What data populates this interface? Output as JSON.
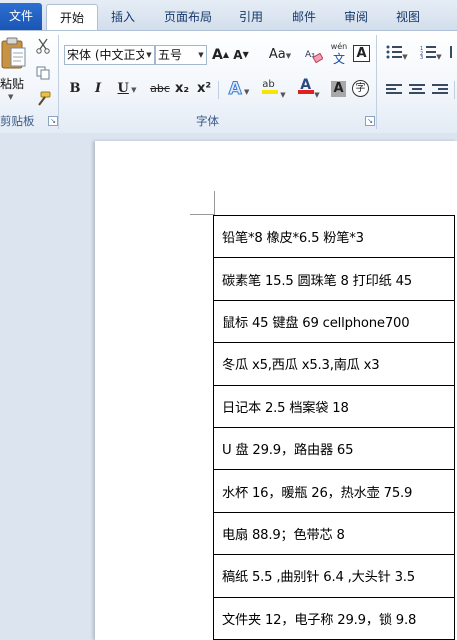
{
  "tabs": [
    {
      "label": "文件",
      "active": false
    },
    {
      "label": "开始",
      "active": true
    },
    {
      "label": "插入",
      "active": false
    },
    {
      "label": "页面布局",
      "active": false
    },
    {
      "label": "引用",
      "active": false
    },
    {
      "label": "邮件",
      "active": false
    },
    {
      "label": "审阅",
      "active": false
    },
    {
      "label": "视图",
      "active": false
    }
  ],
  "clipboard": {
    "paste_label": "粘贴",
    "group_label": "剪贴板"
  },
  "font": {
    "font_name": "宋体 (中文正文",
    "font_size": "五号",
    "group_label": "字体",
    "phonetic_glyph": "wén",
    "phonetic_glyph_base": "文",
    "change_case_label": "Aa",
    "bold_label": "B",
    "italic_label": "I",
    "underline_label": "U",
    "strike_label": "abc",
    "subscript_label": "x₂",
    "superscript_label": "x²",
    "text_effect_label": "A",
    "font_color_label": "A",
    "shading_label": "A",
    "enclose_label": "字",
    "highlight_label": "ab",
    "grow_label": "A",
    "shrink_label": "A",
    "border_label": "A",
    "font_color": "#e02020",
    "highlight_color": "#f5e600"
  },
  "table": {
    "rows": [
      "铅笔*8 橡皮*6.5 粉笔*3",
      "碳素笔 15.5  圆珠笔 8  打印纸 45",
      "鼠标 45  键盘 69 cellphone700",
      "冬瓜 x5,西瓜 x5.3,南瓜 x3",
      "日记本 2.5  档案袋 18",
      "U 盘 29.9，路由器 65",
      "水杯 16，暖瓶 26，热水壶 75.9",
      "电扇 88.9；色带芯 8",
      "稿纸 5.5 ,曲别针 6.4 ,大头针 3.5",
      "文件夹 12，电子称 29.9，锁 9.8"
    ]
  }
}
